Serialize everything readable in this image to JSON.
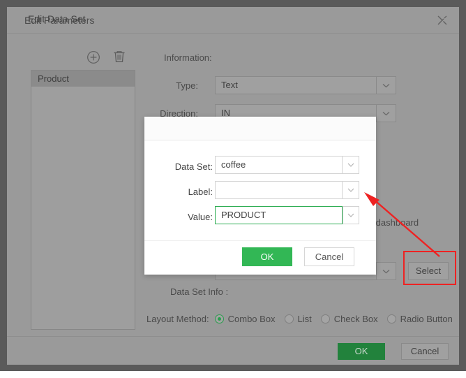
{
  "window": {
    "title": "Edit Parameters",
    "close_icon": "close-icon"
  },
  "left_panel": {
    "add_icon": "circle-plus-icon",
    "delete_icon": "trash-icon",
    "items": [
      {
        "label": "Product",
        "selected": true
      }
    ]
  },
  "form": {
    "information_label": "Information:",
    "type_label": "Type:",
    "type_value": "Text",
    "direction_label": "Direction:",
    "direction_value": "IN",
    "hint_text": "\" of dashboard",
    "assoc_value": "",
    "select_button": "Select",
    "dataset_info_label": "Data Set Info :",
    "layout_method_label": "Layout Method:",
    "layout_options": [
      {
        "label": "Combo Box",
        "checked": true
      },
      {
        "label": "List",
        "checked": false
      },
      {
        "label": "Check Box",
        "checked": false
      },
      {
        "label": "Radio Button",
        "checked": false
      }
    ],
    "dropdown_icon": "chevron-down-icon"
  },
  "footer": {
    "ok_label": "OK",
    "cancel_label": "Cancel"
  },
  "modal": {
    "title": "Edit Data Set",
    "close_icon": "close-icon",
    "dataset_label": "Data Set:",
    "dataset_value": "coffee",
    "label_label": "Label:",
    "label_value": "",
    "value_label": "Value:",
    "value_value": "PRODUCT",
    "ok_label": "OK",
    "cancel_label": "Cancel",
    "dropdown_icon": "chevron-down-icon"
  },
  "annotations": {
    "arrow_color": "#ee2222",
    "highlight_color": "#ee2222",
    "arrow_name": "red-pointer-arrow",
    "highlight_target": "Select"
  }
}
